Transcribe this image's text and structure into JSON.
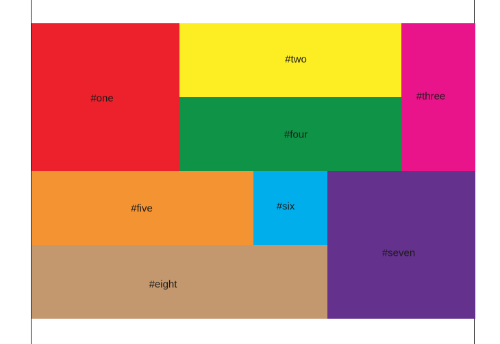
{
  "cells": [
    {
      "id": "one",
      "label": "#one",
      "color": "#ec212c"
    },
    {
      "id": "two",
      "label": "#two",
      "color": "#fdee23"
    },
    {
      "id": "three",
      "label": "#three",
      "color": "#e9148a"
    },
    {
      "id": "four",
      "label": "#four",
      "color": "#0f9346"
    },
    {
      "id": "five",
      "label": "#five",
      "color": "#f39331"
    },
    {
      "id": "six",
      "label": "#six",
      "color": "#00aeec"
    },
    {
      "id": "seven",
      "label": "#seven",
      "color": "#64318d"
    },
    {
      "id": "eight",
      "label": "#eight",
      "color": "#c3986e"
    }
  ]
}
